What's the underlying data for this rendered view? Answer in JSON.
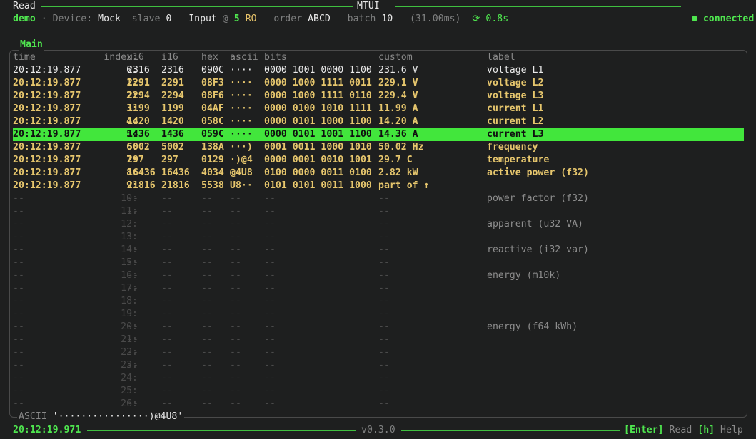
{
  "top": {
    "left_title": "Read",
    "center_title": "MTUI",
    "status": "connected"
  },
  "info": {
    "profile": "demo",
    "device_label": "Device:",
    "device": "Mock",
    "slave_label": "slave",
    "slave": "0",
    "kind": "Input",
    "at": "@",
    "address": "5",
    "mode": "RO",
    "order_label": "order",
    "order": "ABCD",
    "batch_label": "batch",
    "batch": "10",
    "duration": "(31.00ms)",
    "refresh": "0.8s"
  },
  "main": {
    "title": "Main",
    "columns": [
      "time",
      "index:",
      "u16",
      "i16",
      "hex",
      "ascii",
      "bits",
      "custom",
      "label"
    ],
    "rows": [
      {
        "time": "20:12:19.877",
        "index": "0:",
        "u16": "2316",
        "i16": "2316",
        "hex": "090C",
        "ascii": "····",
        "bits": "0000 1001 0000 1100",
        "custom": "231.6 V",
        "label": "voltage L1"
      },
      {
        "time": "20:12:19.877",
        "index": "1:",
        "u16": "2291",
        "i16": "2291",
        "hex": "08F3",
        "ascii": "····",
        "bits": "0000 1000 1111 0011",
        "custom": "229.1 V",
        "label": "voltage L2"
      },
      {
        "time": "20:12:19.877",
        "index": "2:",
        "u16": "2294",
        "i16": "2294",
        "hex": "08F6",
        "ascii": "····",
        "bits": "0000 1000 1111 0110",
        "custom": "229.4 V",
        "label": "voltage L3"
      },
      {
        "time": "20:12:19.877",
        "index": "3:",
        "u16": "1199",
        "i16": "1199",
        "hex": "04AF",
        "ascii": "····",
        "bits": "0000 0100 1010 1111",
        "custom": "11.99 A",
        "label": "current L1"
      },
      {
        "time": "20:12:19.877",
        "index": "4:",
        "u16": "1420",
        "i16": "1420",
        "hex": "058C",
        "ascii": "····",
        "bits": "0000 0101 1000 1100",
        "custom": "14.20 A",
        "label": "current L2"
      },
      {
        "time": "20:12:19.877",
        "index": "5:",
        "u16": "1436",
        "i16": "1436",
        "hex": "059C",
        "ascii": "····",
        "bits": "0000 0101 1001 1100",
        "custom": "14.36 A",
        "label": "current L3"
      },
      {
        "time": "20:12:19.877",
        "index": "6:",
        "u16": "5002",
        "i16": "5002",
        "hex": "138A",
        "ascii": "···)",
        "bits": "0001 0011 1000 1010",
        "custom": "50.02 Hz",
        "label": "frequency"
      },
      {
        "time": "20:12:19.877",
        "index": "7:",
        "u16": "297",
        "i16": "297",
        "hex": "0129",
        "ascii": "·)@4",
        "bits": "0000 0001 0010 1001",
        "custom": "29.7 C",
        "label": "temperature"
      },
      {
        "time": "20:12:19.877",
        "index": "8:",
        "u16": "16436",
        "i16": "16436",
        "hex": "4034",
        "ascii": "@4U8",
        "bits": "0100 0000 0011 0100",
        "custom": "2.82 kW",
        "label": "active power (f32)"
      },
      {
        "time": "20:12:19.877",
        "index": "9:",
        "u16": "21816",
        "i16": "21816",
        "hex": "5538",
        "ascii": "U8··",
        "bits": "0101 0101 0011 1000",
        "custom": "part of ↑",
        "label": ""
      }
    ],
    "empty_rows": [
      {
        "index": "10:",
        "label": "power factor (f32)"
      },
      {
        "index": "11:",
        "label": ""
      },
      {
        "index": "12:",
        "label": "apparent (u32 VA)"
      },
      {
        "index": "13:",
        "label": ""
      },
      {
        "index": "14:",
        "label": "reactive (i32 var)"
      },
      {
        "index": "15:",
        "label": ""
      },
      {
        "index": "16:",
        "label": "energy (m10k)"
      },
      {
        "index": "17:",
        "label": ""
      },
      {
        "index": "18:",
        "label": ""
      },
      {
        "index": "19:",
        "label": ""
      },
      {
        "index": "20:",
        "label": "energy (f64 kWh)"
      },
      {
        "index": "21:",
        "label": ""
      },
      {
        "index": "22:",
        "label": ""
      },
      {
        "index": "23:",
        "label": ""
      },
      {
        "index": "24:",
        "label": ""
      },
      {
        "index": "25:",
        "label": ""
      },
      {
        "index": "26:",
        "label": ""
      }
    ],
    "placeholder": "--",
    "selected_index": 5,
    "ascii_label": "ASCII",
    "ascii_value": "'················)@4U8'"
  },
  "footer": {
    "time": "20:12:19.971",
    "version": "v0.3.0",
    "key_enter": "[Enter]",
    "enter_label": "Read",
    "key_help": "[h]",
    "help_label": "Help"
  }
}
